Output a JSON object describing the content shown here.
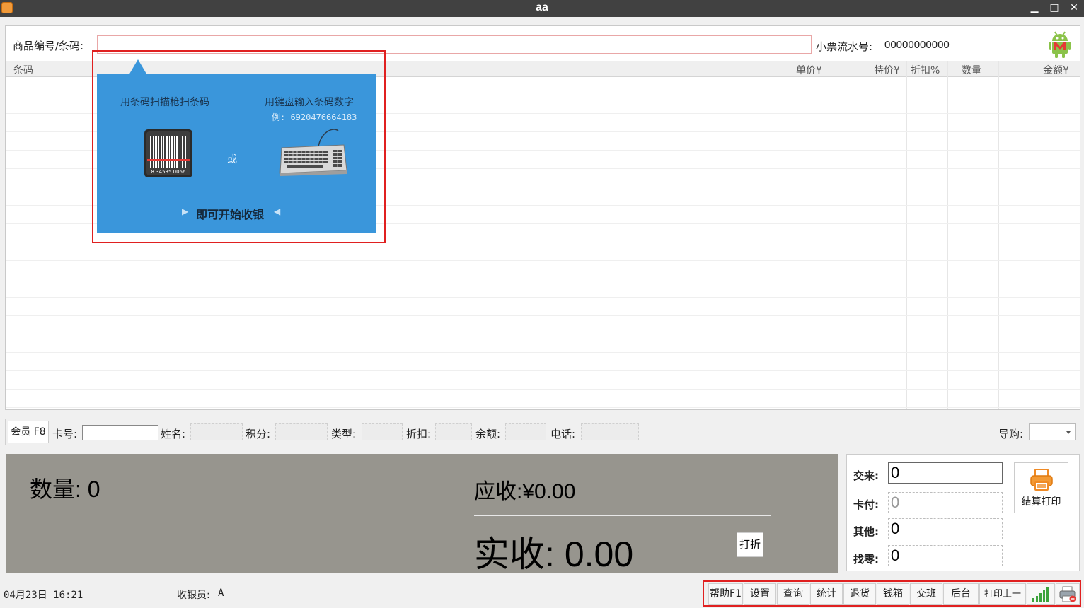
{
  "window": {
    "title": "aa",
    "minimize": "▁",
    "maximize": "□",
    "close": "✕"
  },
  "search": {
    "label": "商品编号/条码:",
    "value": "",
    "placeholder": ""
  },
  "receipt": {
    "label": "小票流水号:",
    "number": "00000000000"
  },
  "logo": {
    "icon": "android-m-logo"
  },
  "grid": {
    "columns": [
      "条码",
      "单价¥",
      "特价¥",
      "折扣%",
      "数量",
      "金额¥"
    ],
    "rows": []
  },
  "guide": {
    "scan_text": "用条码扫描枪扫条码",
    "keyboard_text": "用键盘输入条码数字",
    "example": "例: 6920476664183",
    "or": "或",
    "barcode_number": "8 34535 0056",
    "start_text": "即可开始收银",
    "arrow_left": "▶",
    "arrow_right": "◀",
    "panel_color": "#3a96db",
    "highlight_color": "#e02020"
  },
  "member": {
    "button": "会员 F8",
    "card_label": "卡号:",
    "card_value": "",
    "name_label": "姓名:",
    "points_label": "积分:",
    "type_label": "类型:",
    "discount_label": "折扣:",
    "balance_label": "余额:",
    "phone_label": "电话:",
    "guide_label": "导购:",
    "guide_value": ""
  },
  "totals": {
    "quantity_label": "数量:",
    "quantity": "0",
    "due_label": "应收:",
    "due": "¥0.00",
    "actual_label": "实收:",
    "actual": "0.00",
    "discount_button": "打折"
  },
  "payment": {
    "tendered_label": "交来:",
    "tendered": "0",
    "card_label": "卡付:",
    "card": "0",
    "other_label": "其他:",
    "other": "0",
    "change_label": "找零:",
    "change": "0",
    "settle_button": "结算打印"
  },
  "status": {
    "date": "04月23日 16:21",
    "cashier_label": "收银员:",
    "cashier": "A"
  },
  "toolbar": {
    "help": "帮助F1",
    "settings": "设置",
    "query": "查询",
    "stats": "统计",
    "returns": "退货",
    "cashbox": "钱箱",
    "shift": "交班",
    "backend": "后台",
    "reprint": "打印上一单",
    "signal_icon": "signal-bars-icon",
    "printer_icon": "printer-status-icon"
  }
}
